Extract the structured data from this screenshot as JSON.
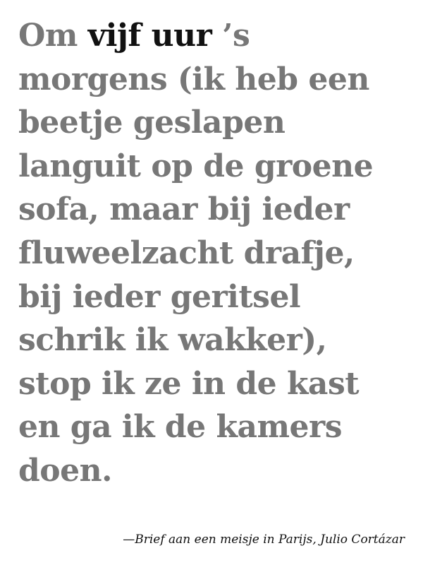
{
  "quote": {
    "line1_start": "Om ",
    "line1_emphasis": "vijf uur",
    "line1_end": " ’s",
    "lines": [
      "morgens (ik heb een",
      "beetje geslapen",
      "languit op de groene",
      "sofa, maar bij ieder",
      "fluweelzacht drafje,",
      "bij ieder geritsel",
      "schrik ik wakker),",
      "stop ik ze in de kast",
      "en ga ik de kamers",
      "doen."
    ]
  },
  "attribution": "—Brief aan een meisje in Parijs, Julio Cortázar",
  "colors": {
    "text": "#777777",
    "emphasis": "#111111",
    "background": "#ffffff"
  }
}
